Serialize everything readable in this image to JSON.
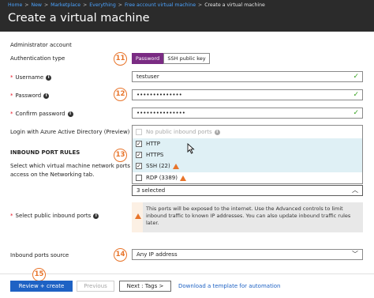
{
  "breadcrumb": {
    "items": [
      "Home",
      "New",
      "Marketplace",
      "Everything",
      "Free account virtual machine"
    ],
    "current": "Create a virtual machine"
  },
  "page_title": "Create a virtual machine",
  "admin_section": "Administrator account",
  "auth": {
    "label": "Authentication type",
    "options": [
      "Password",
      "SSH public key"
    ],
    "selected": "Password"
  },
  "username": {
    "label": "Username",
    "value": "testuser"
  },
  "password": {
    "label": "Password",
    "value": "••••••••••••••"
  },
  "confirm_password": {
    "label": "Confirm password",
    "value": "•••••••••••••••"
  },
  "aad_login": {
    "label": "Login with Azure Active Directory (Preview)"
  },
  "inbound": {
    "section_title": "INBOUND PORT RULES",
    "description": "Select which virtual machine network ports are accessible from the public internet. You can specify more limited or granular network access on the Networking tab.",
    "description_visible_line1": "Select which virtual machine network ports are",
    "description_visible_line2": "access on the Networking tab.",
    "select_label": "Select public inbound ports",
    "options": [
      {
        "label": "No public inbound ports",
        "checked": false,
        "disabled": true,
        "info": true,
        "warn": false
      },
      {
        "label": "HTTP",
        "checked": true,
        "disabled": false,
        "info": false,
        "warn": false
      },
      {
        "label": "HTTPS",
        "checked": true,
        "disabled": false,
        "info": false,
        "warn": false
      },
      {
        "label": "SSH (22)",
        "checked": true,
        "disabled": false,
        "info": false,
        "warn": true
      },
      {
        "label": "RDP (3389)",
        "checked": false,
        "disabled": false,
        "info": false,
        "warn": true
      }
    ],
    "selected_summary": "3 selected",
    "warning_text": "This ports will be exposed to the internet. Use the Advanced controls to limit inbound traffic to known IP addresses. You can also update inbound traffic rules later."
  },
  "ports_source": {
    "label": "Inbound ports source",
    "value": "Any IP address"
  },
  "buttons": {
    "review": "Review + create",
    "previous": "Previous",
    "next": "Next : Tags >",
    "download": "Download a template for automation"
  },
  "callouts": [
    "11",
    "12",
    "13",
    "14",
    "15"
  ],
  "colors": {
    "accent": "#7a2b83",
    "primary": "#1e62c4",
    "callout": "#e8742a",
    "valid": "#38a321",
    "dropdown_bg": "#dff0f5",
    "warning_bg": "#e8e8e8"
  }
}
